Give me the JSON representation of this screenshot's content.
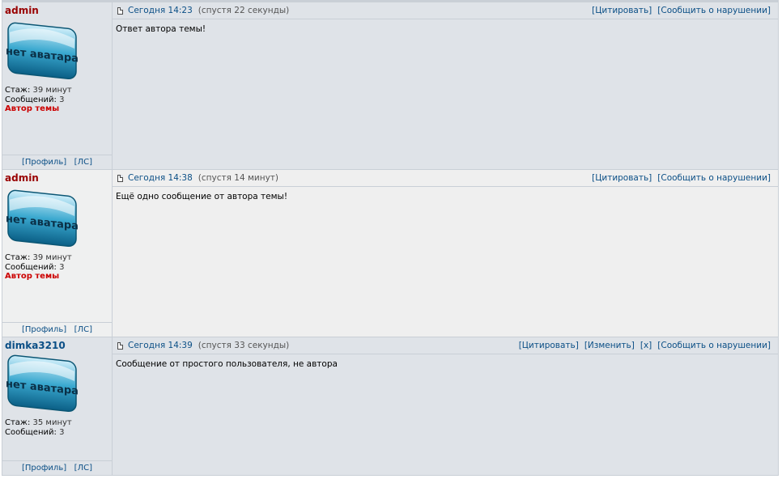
{
  "posts": [
    {
      "author": "admin",
      "author_role": "admin",
      "avatar_text": "нет аватара",
      "stazh_label": "Стаж:",
      "stazh_value": "39 минут",
      "msgs_label": "Сообщений:",
      "msgs_value": "3",
      "topic_author": "Автор темы",
      "profile_link": "[Профиль]",
      "pm_link": "[ЛС]",
      "date": "Сегодня 14:23",
      "ago": "(спустя 22 секунды)",
      "links": [
        "[Цитировать]",
        "[Сообщить о нарушении]"
      ],
      "body": "Ответ автора темы!"
    },
    {
      "author": "admin",
      "author_role": "admin",
      "avatar_text": "нет аватара",
      "stazh_label": "Стаж:",
      "stazh_value": "39 минут",
      "msgs_label": "Сообщений:",
      "msgs_value": "3",
      "topic_author": "Автор темы",
      "profile_link": "[Профиль]",
      "pm_link": "[ЛС]",
      "date": "Сегодня 14:38",
      "ago": "(спустя 14 минут)",
      "links": [
        "[Цитировать]",
        "[Сообщить о нарушении]"
      ],
      "body": "Ещё одно сообщение от автора темы!"
    },
    {
      "author": "dimka3210",
      "author_role": "user",
      "avatar_text": "нет аватара",
      "stazh_label": "Стаж:",
      "stazh_value": "35 минут",
      "msgs_label": "Сообщений:",
      "msgs_value": "3",
      "profile_link": "[Профиль]",
      "pm_link": "[ЛС]",
      "date": "Сегодня 14:39",
      "ago": "(спустя 33 секунды)",
      "links": [
        "[Цитировать]",
        "[Изменить]",
        "[x]",
        "[Сообщить о нарушении]"
      ],
      "body": "Сообщение от простого пользователя, не автора"
    }
  ],
  "colors": {
    "admin_name": "#990000",
    "user_name": "#0b4f86",
    "topic_author": "#cc0000",
    "link": "#0b4f86",
    "row_odd": "#dfe3e8",
    "row_even": "#efefef",
    "border": "#c9cfd6"
  }
}
